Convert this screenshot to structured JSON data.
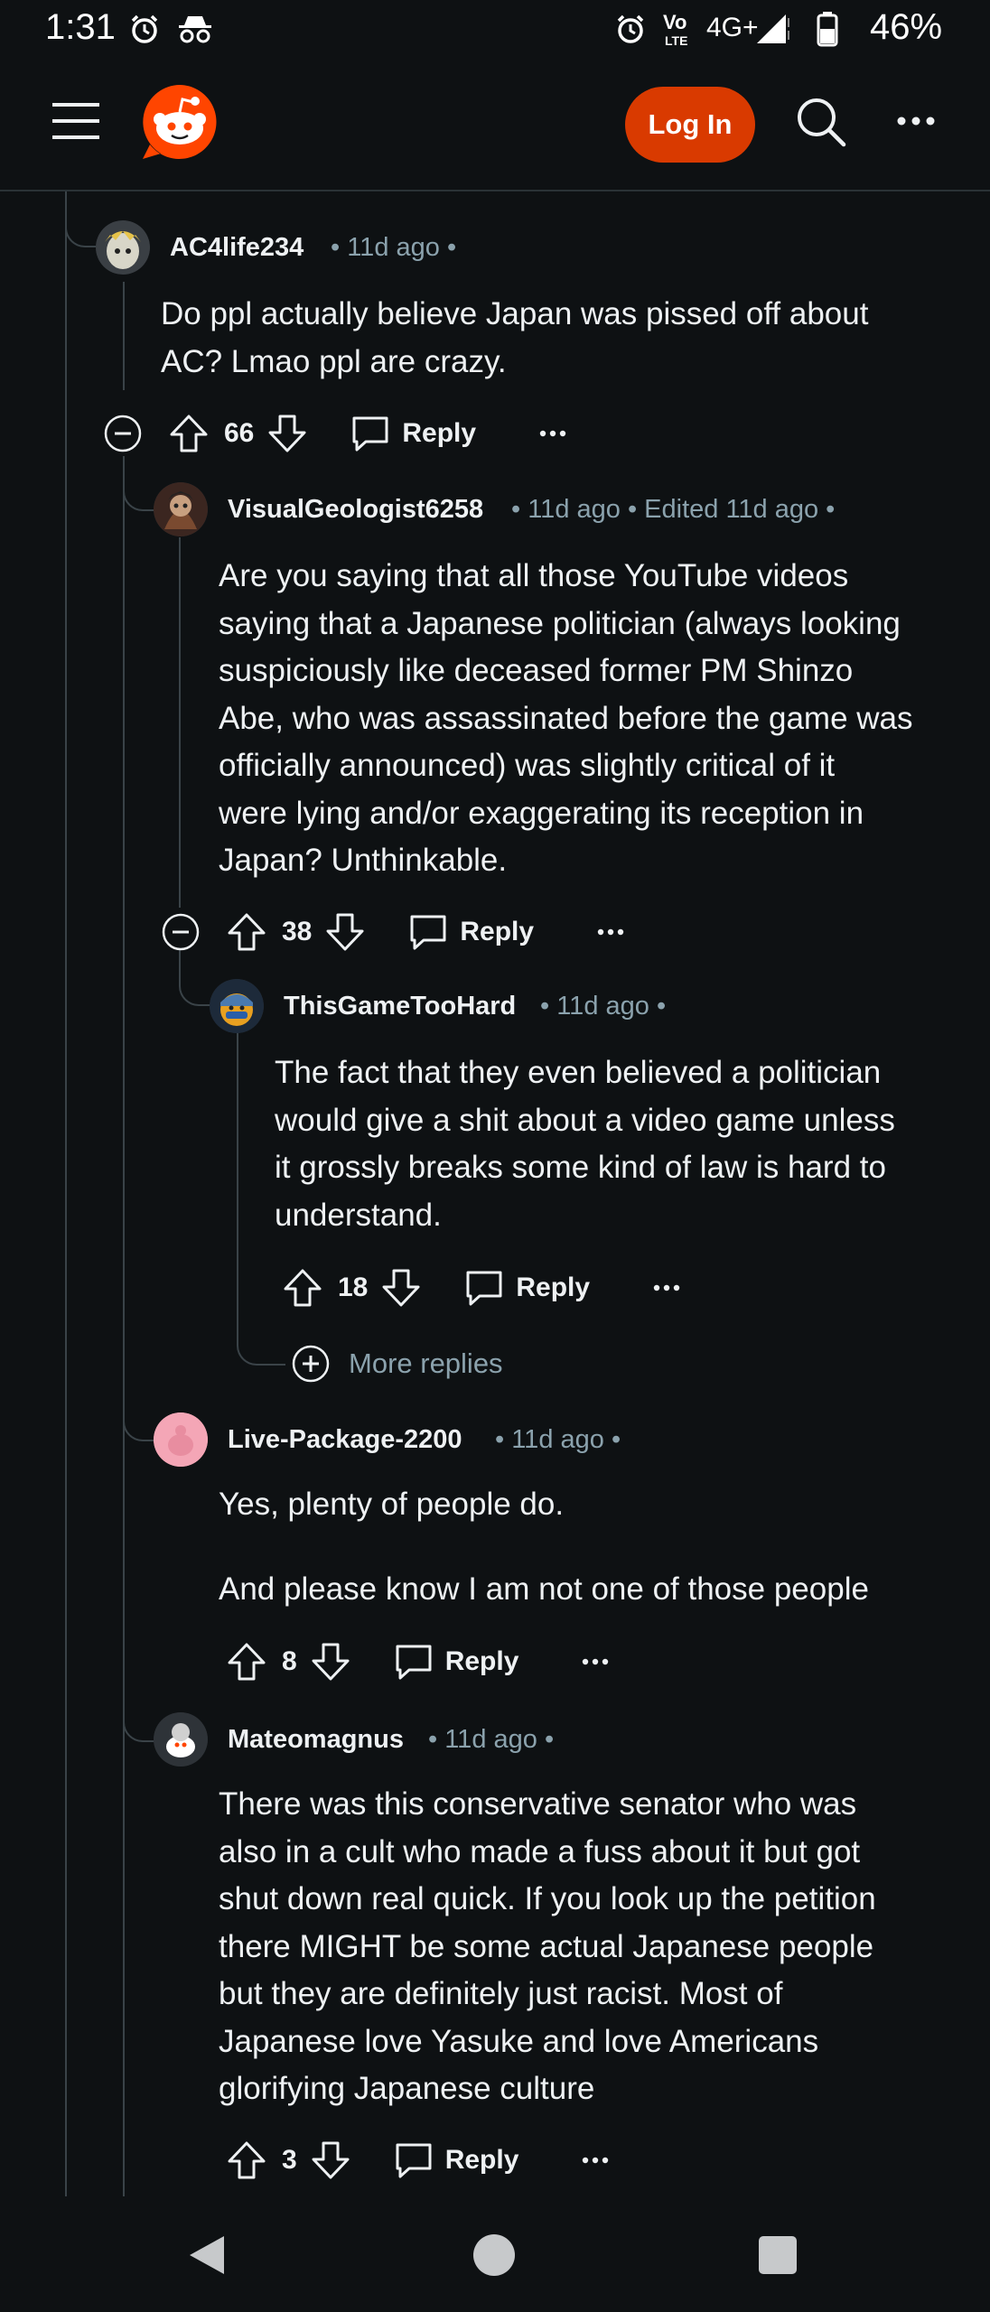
{
  "status_bar": {
    "time": "1:31",
    "network": "4G+",
    "battery": "46%",
    "icons": [
      "alarm-icon",
      "incognito-icon",
      "alarm-icon",
      "volte-icon",
      "signal-icon",
      "battery-icon"
    ]
  },
  "header": {
    "login_label": "Log In",
    "icons": [
      "menu-icon",
      "reddit-logo-icon",
      "search-icon",
      "more-icon"
    ],
    "accent": "#d93a00"
  },
  "comments": [
    {
      "username": "AC4life234",
      "meta": "• 11d ago •",
      "lines": [
        "Do ppl actually believe Japan was pissed off about",
        "AC? Lmao ppl are crazy."
      ],
      "votes": "66",
      "reply_label": "Reply"
    },
    {
      "username": "VisualGeologist6258",
      "meta": "• 11d ago • Edited 11d ago •",
      "lines": [
        "Are you saying that all those YouTube videos",
        "saying that a Japanese politician (always looking",
        "suspiciously like deceased former PM Shinzo",
        "Abe, who was assassinated before the game was",
        "officially announced) was slightly critical of it",
        "were lying and/or exaggerating its reception in",
        "Japan? Unthinkable."
      ],
      "votes": "38",
      "reply_label": "Reply"
    },
    {
      "username": "ThisGameTooHard",
      "meta": "• 11d ago •",
      "lines": [
        "The fact that they even believed a politician",
        "would give a shit about a video game unless",
        "it grossly breaks some kind of law is hard to",
        "understand."
      ],
      "votes": "18",
      "reply_label": "Reply"
    },
    {
      "username": "Live-Package-2200",
      "meta": "• 11d ago •",
      "lines": [
        "Yes, plenty of people do.",
        "",
        "And please know I am not one of those people"
      ],
      "votes": "8",
      "reply_label": "Reply"
    },
    {
      "username": "Mateomagnus",
      "meta": "• 11d ago •",
      "lines": [
        "There was this conservative senator who was",
        "also in a cult who made a fuss about it but got",
        "shut down real quick. If you look up the petition",
        "there MIGHT be some actual Japanese people",
        "but they are definitely just racist. Most of",
        "Japanese love Yasuke and love Americans",
        "glorifying Japanese culture"
      ],
      "votes": "3",
      "reply_label": "Reply"
    }
  ],
  "more_replies_label": "More replies",
  "nav_bar": {
    "icons": [
      "back-icon",
      "home-icon",
      "recents-icon"
    ]
  }
}
